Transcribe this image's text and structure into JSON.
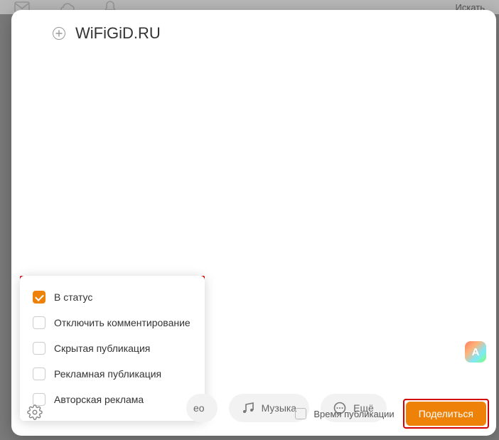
{
  "bg": {
    "search_placeholder": "Искать"
  },
  "modal": {
    "title": "WiFiGiD.RU"
  },
  "options": [
    {
      "label": "В статус",
      "checked": true
    },
    {
      "label": "Отключить комментирование",
      "checked": false
    },
    {
      "label": "Скрытая публикация",
      "checked": false
    },
    {
      "label": "Рекламная публикация",
      "checked": false
    },
    {
      "label": "Авторская реклама",
      "checked": false
    }
  ],
  "ai_badge": "A",
  "pills": {
    "frag": "ео",
    "music": "Музыка",
    "more": "Ещё"
  },
  "bottom": {
    "time_label": "Время публикации",
    "share": "Поделиться"
  }
}
